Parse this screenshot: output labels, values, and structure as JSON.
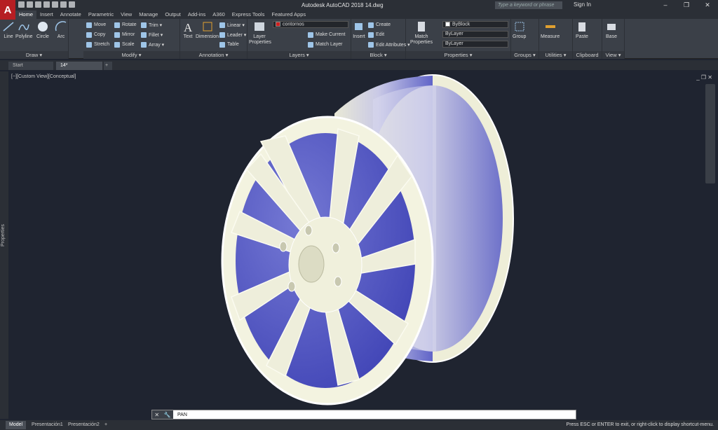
{
  "app": {
    "logo": "A",
    "title": "Autodesk AutoCAD 2018    14.dwg",
    "search_placeholder": "Type a keyword or phrase",
    "signin": "Sign In"
  },
  "window": {
    "minimize": "–",
    "restore": "❐",
    "close": "✕"
  },
  "ribbon_tabs": [
    "Home",
    "Insert",
    "Annotate",
    "Parametric",
    "View",
    "Manage",
    "Output",
    "Add-ins",
    "A360",
    "Express Tools",
    "Featured Apps"
  ],
  "draw": {
    "title": "Draw ▾",
    "line": "Line",
    "polyline": "Polyline",
    "circle": "Circle",
    "arc": "Arc"
  },
  "modify": {
    "title": "Modify ▾",
    "move": "Move",
    "rotate": "Rotate",
    "trim": "Trim ▾",
    "copy": "Copy",
    "mirror": "Mirror",
    "fillet": "Fillet ▾",
    "stretch": "Stretch",
    "scale": "Scale",
    "array": "Array ▾"
  },
  "annotation": {
    "title": "Annotation ▾",
    "text": "Text",
    "dimension": "Dimension",
    "linear": "Linear ▾",
    "leader": "Leader ▾",
    "table": "Table"
  },
  "layers": {
    "title": "Layers ▾",
    "properties": "Layer Properties",
    "current_layer": "contornos",
    "make_current": "Make Current",
    "match_layer": "Match Layer"
  },
  "block": {
    "title": "Block ▾",
    "insert": "Insert",
    "create": "Create",
    "edit": "Edit",
    "edit_attributes": "Edit Attributes ▾"
  },
  "properties": {
    "title": "Properties ▾",
    "match": "Match Properties",
    "color": "ByBlock",
    "linetype": "ByLayer",
    "lineweight": "ByLayer"
  },
  "groups": {
    "title": "Groups ▾",
    "group": "Group"
  },
  "utilities": {
    "title": "Utilities ▾",
    "measure": "Measure"
  },
  "clipboard": {
    "title": "Clipboard",
    "paste": "Paste"
  },
  "view": {
    "title": "View ▾",
    "base": "Base"
  },
  "doc_tabs": {
    "start": "Start",
    "current": "14*",
    "plus": "+"
  },
  "viewport": {
    "label": "[−][Custom View][Conceptual]",
    "controls": "_ ❐ ✕"
  },
  "side_palette": "Properties",
  "command": {
    "value": "PAN",
    "cancel": "✕",
    "options": "🔧"
  },
  "status": {
    "tabs": [
      "Model",
      "Presentación1",
      "Presentación2",
      "+"
    ],
    "message": "Press ESC or ENTER to exit, or right-click to display shortcut-menu."
  },
  "colors": {
    "accent": "#b61e23",
    "rim_face": "#eeeed8",
    "rim_shade": "#4b4fbf"
  }
}
